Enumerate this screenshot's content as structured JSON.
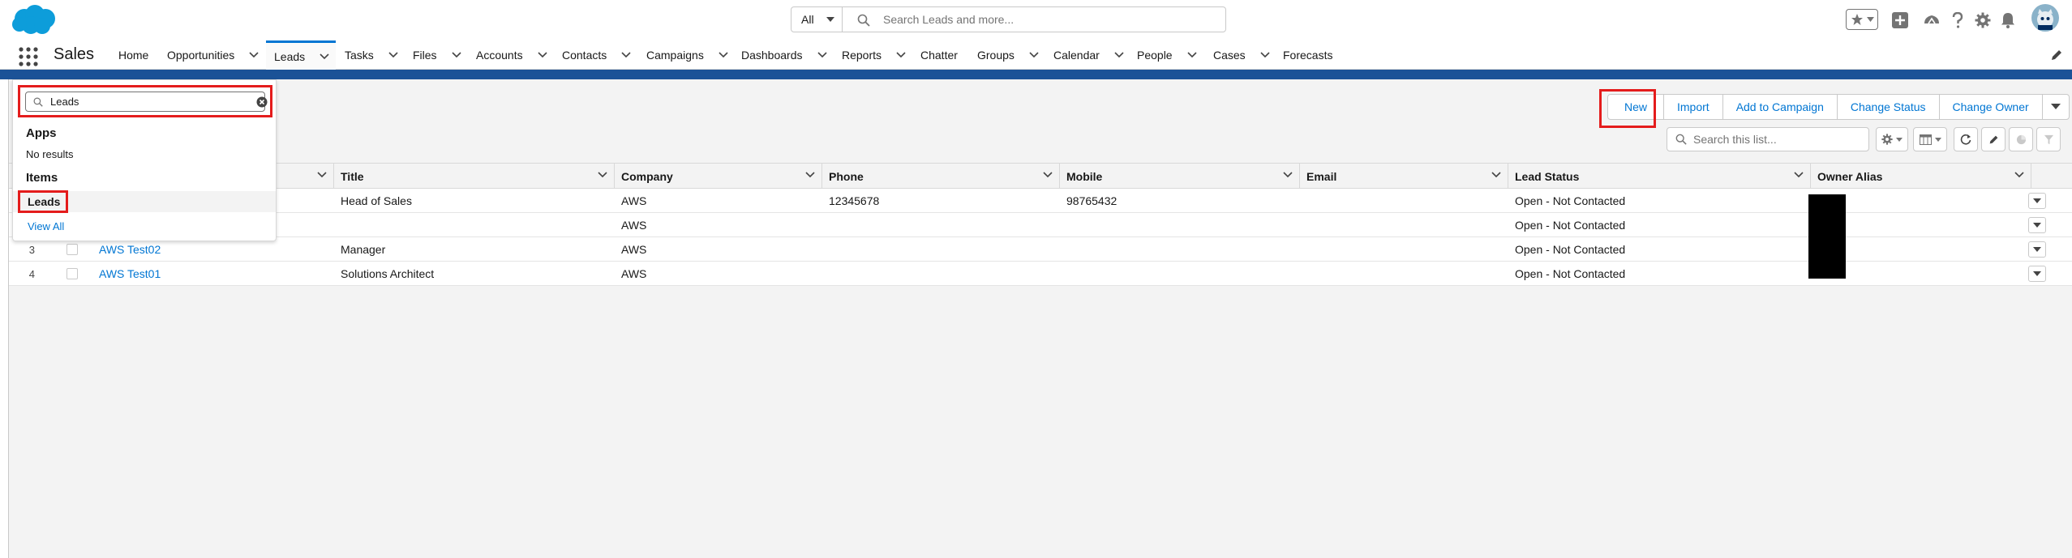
{
  "header": {
    "search_scope": "All",
    "search_placeholder": "Search Leads and more..."
  },
  "nav": {
    "app_name": "Sales",
    "items": [
      {
        "label": "Home",
        "has_menu": false
      },
      {
        "label": "Opportunities",
        "has_menu": true
      },
      {
        "label": "Leads",
        "has_menu": true,
        "active": true
      },
      {
        "label": "Tasks",
        "has_menu": true
      },
      {
        "label": "Files",
        "has_menu": true
      },
      {
        "label": "Accounts",
        "has_menu": true
      },
      {
        "label": "Contacts",
        "has_menu": true
      },
      {
        "label": "Campaigns",
        "has_menu": true
      },
      {
        "label": "Dashboards",
        "has_menu": true
      },
      {
        "label": "Reports",
        "has_menu": true
      },
      {
        "label": "Chatter",
        "has_menu": false
      },
      {
        "label": "Groups",
        "has_menu": true
      },
      {
        "label": "Calendar",
        "has_menu": true
      },
      {
        "label": "People",
        "has_menu": true
      },
      {
        "label": "Cases",
        "has_menu": true
      },
      {
        "label": "Forecasts",
        "has_menu": false
      }
    ]
  },
  "actions": {
    "new": "New",
    "import": "Import",
    "add_to_campaign": "Add to Campaign",
    "change_status": "Change Status",
    "change_owner": "Change Owner"
  },
  "list_search": {
    "placeholder": "Search this list..."
  },
  "table": {
    "columns": [
      "Title",
      "Company",
      "Phone",
      "Mobile",
      "Email",
      "Lead Status",
      "Owner Alias"
    ],
    "rows": [
      {
        "num": "",
        "name": "",
        "title": "Head of Sales",
        "company": "AWS",
        "phone": "12345678",
        "mobile": "98765432",
        "email": "",
        "status": "Open - Not Contacted"
      },
      {
        "num": "",
        "name": "",
        "title": "",
        "company": "AWS",
        "phone": "",
        "mobile": "",
        "email": "",
        "status": "Open - Not Contacted"
      },
      {
        "num": "3",
        "name": "AWS Test02",
        "title": "Manager",
        "company": "AWS",
        "phone": "",
        "mobile": "",
        "email": "",
        "status": "Open - Not Contacted"
      },
      {
        "num": "4",
        "name": "AWS Test01",
        "title": "Solutions Architect",
        "company": "AWS",
        "phone": "",
        "mobile": "",
        "email": "",
        "status": "Open - Not Contacted"
      }
    ]
  },
  "dropdown": {
    "input_value": "Leads",
    "apps_heading": "Apps",
    "no_results": "No results",
    "items_heading": "Items",
    "item_leads": "Leads",
    "view_all": "View All"
  },
  "colors": {
    "brand_blue": "#0176d3",
    "header_band": "#1b5297",
    "highlight_red": "#e41c1c"
  }
}
